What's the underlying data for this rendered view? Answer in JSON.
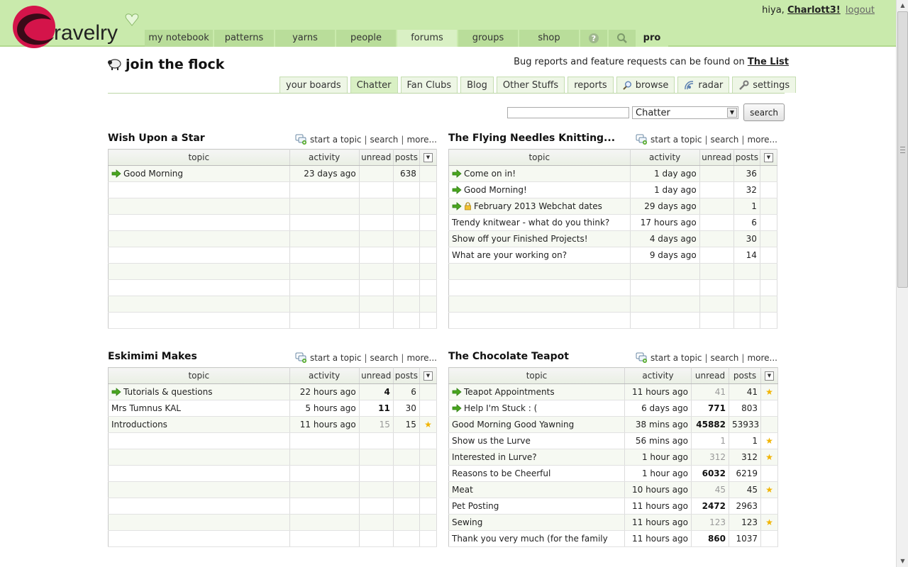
{
  "header": {
    "greeting_prefix": "hiya,",
    "username": "Charlott3!",
    "logout": "logout",
    "nav": [
      {
        "label": "my notebook"
      },
      {
        "label": "patterns"
      },
      {
        "label": "yarns"
      },
      {
        "label": "people"
      },
      {
        "label": "forums"
      },
      {
        "label": "groups"
      },
      {
        "label": "shop"
      }
    ],
    "pro": "pro"
  },
  "page": {
    "title": "join the flock",
    "bug_note_prefix": "Bug reports and feature requests can be found on",
    "bug_note_link": "The List",
    "subtabs": [
      "your boards",
      "Chatter",
      "Fan Clubs",
      "Blog",
      "Other Stuffs",
      "reports",
      "browse",
      "radar",
      "settings"
    ],
    "search": {
      "select_value": "Chatter",
      "button": "search"
    }
  },
  "board_links": {
    "start": "start a topic",
    "search": "search",
    "more": "more..."
  },
  "columns": {
    "topic": "topic",
    "activity": "activity",
    "unread": "unread",
    "posts": "posts"
  },
  "boards": [
    {
      "title": "Wish Upon a Star",
      "rows": [
        {
          "topic": "Good Morning",
          "new": true,
          "activity": "23 days ago",
          "unread": "",
          "posts": "638"
        }
      ]
    },
    {
      "title": "The Flying Needles Knitting...",
      "rows": [
        {
          "topic": "Come on in!",
          "new": true,
          "activity": "1 day ago",
          "unread": "",
          "posts": "36"
        },
        {
          "topic": "Good Morning!",
          "new": true,
          "activity": "1 day ago",
          "unread": "",
          "posts": "32"
        },
        {
          "topic": "February 2013 Webchat dates",
          "new": true,
          "locked": true,
          "activity": "29 days ago",
          "unread": "",
          "posts": "1"
        },
        {
          "topic": "Trendy knitwear - what do you think?",
          "activity": "17 hours ago",
          "unread": "",
          "posts": "6"
        },
        {
          "topic": "Show off your Finished Projects!",
          "activity": "4 days ago",
          "unread": "",
          "posts": "30"
        },
        {
          "topic": "What are your working on?",
          "activity": "9 days ago",
          "unread": "",
          "posts": "14"
        }
      ]
    },
    {
      "title": "Eskimimi Makes",
      "rows": [
        {
          "topic": "Tutorials & questions",
          "new": true,
          "activity": "22 hours ago",
          "unread": "4",
          "unread_style": "bold",
          "posts": "6"
        },
        {
          "topic": "Mrs Tumnus KAL",
          "activity": "5 hours ago",
          "unread": "11",
          "unread_style": "bold",
          "posts": "30"
        },
        {
          "topic": "Introductions",
          "activity": "11 hours ago",
          "unread": "15",
          "unread_style": "grey",
          "posts": "15",
          "star": true
        }
      ]
    },
    {
      "title": "The Chocolate Teapot",
      "rows": [
        {
          "topic": "Teapot Appointments",
          "new": true,
          "activity": "11 hours ago",
          "unread": "41",
          "unread_style": "grey",
          "posts": "41",
          "star": true
        },
        {
          "topic": "Help I'm Stuck : (",
          "new": true,
          "activity": "6 days ago",
          "unread": "771",
          "unread_style": "bold",
          "posts": "803"
        },
        {
          "topic": "Good Morning Good Yawning",
          "activity": "38 mins ago",
          "unread": "45882",
          "unread_style": "bold",
          "posts": "53933"
        },
        {
          "topic": "Show us the Lurve",
          "activity": "56 mins ago",
          "unread": "1",
          "unread_style": "grey",
          "posts": "1",
          "star": true
        },
        {
          "topic": "Interested in Lurve?",
          "activity": "1 hour ago",
          "unread": "312",
          "unread_style": "grey",
          "posts": "312",
          "star": true
        },
        {
          "topic": "Reasons to be Cheerful",
          "activity": "1 hour ago",
          "unread": "6032",
          "unread_style": "bold",
          "posts": "6219"
        },
        {
          "topic": "Meat",
          "activity": "10 hours ago",
          "unread": "45",
          "unread_style": "grey",
          "posts": "45",
          "star": true
        },
        {
          "topic": "Pet Posting",
          "activity": "11 hours ago",
          "unread": "2472",
          "unread_style": "bold",
          "posts": "2963"
        },
        {
          "topic": "Sewing",
          "activity": "11 hours ago",
          "unread": "123",
          "unread_style": "grey",
          "posts": "123",
          "star": true
        },
        {
          "topic": "Thank you very much (for the family",
          "activity": "11 hours ago",
          "unread": "860",
          "unread_style": "bold",
          "posts": "1037"
        }
      ]
    }
  ],
  "colors": {
    "header_bg": "#c9eaac",
    "nav_bg": "#b9dd9a",
    "logo_red": "#d4144a",
    "arrow_green": "#4aa51f",
    "star": "#f2b400"
  }
}
